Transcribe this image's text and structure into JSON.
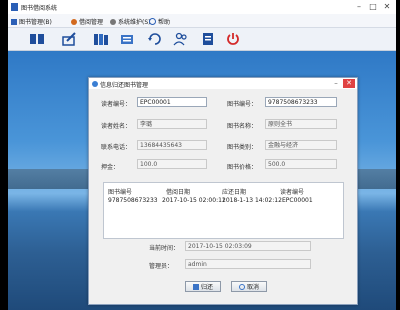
{
  "app": {
    "title": "图书借阅系统"
  },
  "menu": [
    {
      "label": "图书管理(B)",
      "icon": "book-icon"
    },
    {
      "label": "借阅管理",
      "icon": "user-icon"
    },
    {
      "label": "系统维护(S)",
      "icon": "gear-icon"
    },
    {
      "label": "帮助",
      "icon": "help-icon"
    }
  ],
  "dialog": {
    "title": "信息归还图书管理",
    "fields": {
      "reader_id_label": "读者编号：",
      "reader_id_value": "EPC00001",
      "book_id_label": "图书编号：",
      "book_id_value": "9787508673233",
      "reader_name_label": "读者姓名：",
      "reader_name_value": "李璐",
      "book_name_label": "图书名称：",
      "book_name_value": "原则全书",
      "phone_label": "联系电话：",
      "phone_value": "13684435643",
      "category_label": "图书类别：",
      "category_value": "金融与经济",
      "amount_label": "押金：",
      "amount_value": "100.0",
      "price_label": "图书价格：",
      "price_value": "500.0"
    },
    "table": {
      "headers": [
        "图书编号",
        "借阅日期",
        "应还日期",
        "读者编号"
      ],
      "rows": [
        [
          "9787508673233",
          "2017-10-15 02:00:11",
          "2018-1-13 14:02:12",
          "EPC00001"
        ]
      ]
    },
    "current_time_label": "当前时间：",
    "current_time_value": "2017-10-15 02:03:09",
    "operator_label": "管理员：",
    "operator_value": "admin",
    "buttons": {
      "return": "归还",
      "cancel": "取消"
    }
  },
  "colors": {
    "accent": "#2b5fb6",
    "close": "#e04343",
    "desktop_top": "#2f79c6"
  }
}
